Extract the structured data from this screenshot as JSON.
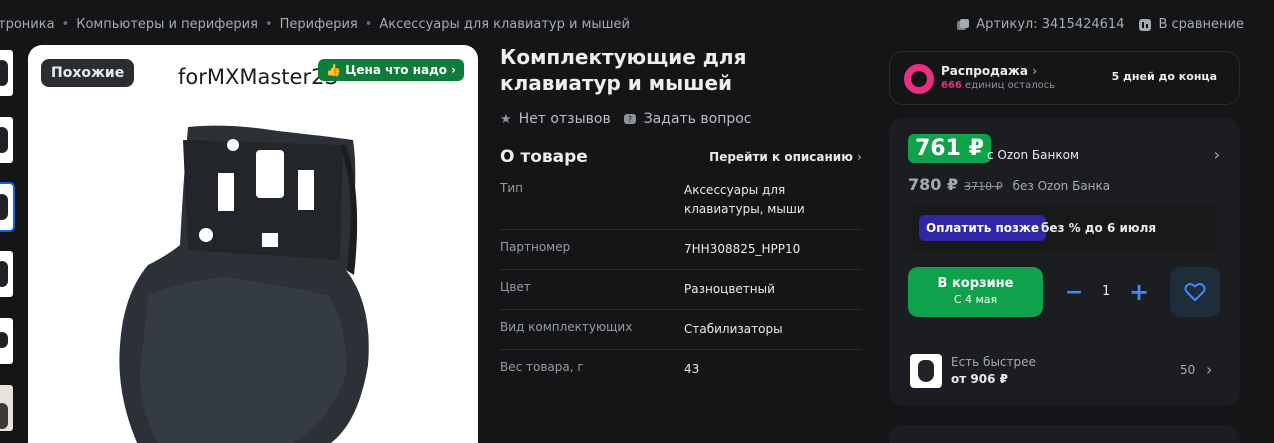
{
  "breadcrumb": {
    "items": [
      "троника",
      "Компьютеры и периферия",
      "Периферия",
      "Аксессуары для клавиатур и мышей"
    ],
    "sep": "•"
  },
  "header_actions": {
    "sku": "Артикул: 3415424614",
    "compare": "В сравнение"
  },
  "gallery": {
    "similar_label": "Похожие",
    "price_badge": "Цена что надо",
    "image_caption": "forMXMaster2S"
  },
  "product": {
    "title": "Комплектующие для клавиатур и мышей",
    "reviews": "Нет отзывов",
    "ask": "Задать вопрос"
  },
  "about": {
    "title": "О товаре",
    "link": "Перейти к описанию",
    "attrs": [
      {
        "key": "Тип",
        "value": "Аксессуары для клавиатуры, мыши"
      },
      {
        "key": "Партномер",
        "value": "7HH308825_HPP10"
      },
      {
        "key": "Цвет",
        "value": "Разноцветный"
      },
      {
        "key": "Вид комплектующих",
        "value": "Стабилизаторы"
      },
      {
        "key": "Вес товара, г",
        "value": "43"
      }
    ]
  },
  "sale": {
    "title": "Распродажа",
    "count": "666",
    "count_suffix": " единиц осталось",
    "days": "5 дней до конца"
  },
  "buy": {
    "price_bank": "761 ₽",
    "bank_label": "с Ozon Банком",
    "price_regular": "780 ₽",
    "price_old": "3710 ₽",
    "no_bank_label": "без Ozon Банка",
    "later_btn": "Оплатить позже",
    "later_text": "без % до 6 июля",
    "cart_line1": "В корзине",
    "cart_line2": "С 4 мая",
    "qty": "1",
    "faster_title": "Есть быстрее",
    "faster_price": "от 906 ₽",
    "faster_count": "50"
  },
  "colors": {
    "accent_green": "#10a24a",
    "accent_pink": "#e92f82",
    "accent_blue": "#3b8cff",
    "later_purple": "#2f27a6"
  }
}
